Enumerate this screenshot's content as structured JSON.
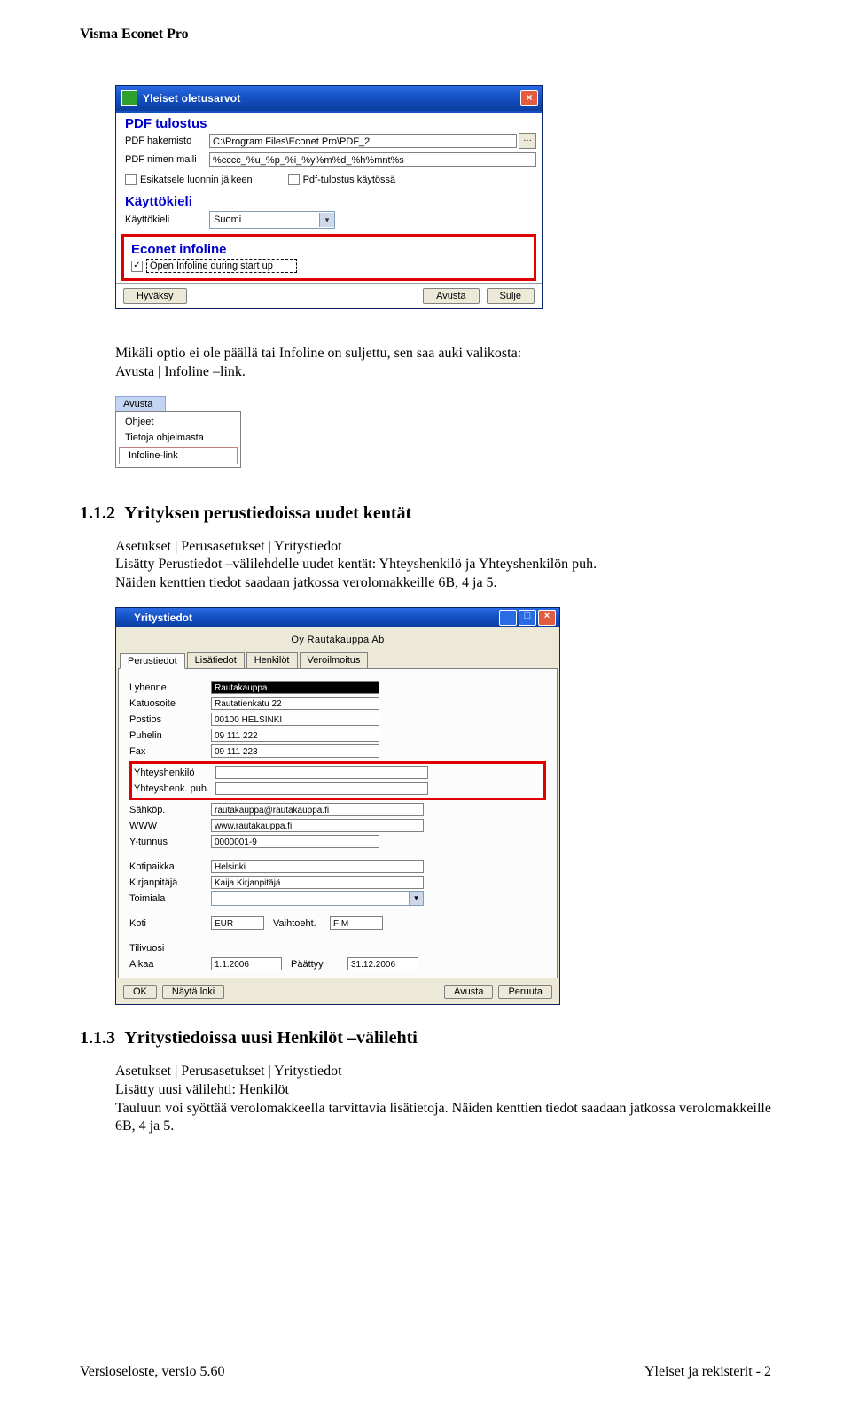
{
  "header": "Visma Econet Pro",
  "dialog1": {
    "title": "Yleiset oletusarvot",
    "section1": "PDF tulostus",
    "pdf_dir_label": "PDF hakemisto",
    "pdf_dir_value": "C:\\Program Files\\Econet Pro\\PDF_2",
    "pdf_name_label": "PDF nimen malli",
    "pdf_name_value": "%cccc_%u_%p_%i_%y%m%d_%h%mnt%s",
    "chk_preview": "Esikatsele luonnin jälkeen",
    "chk_enable": "Pdf-tulostus käytössä",
    "section2": "Käyttökieli",
    "lang_label": "Käyttökieli",
    "lang_value": "Suomi",
    "section3": "Econet infoline",
    "chk_open": "Open Infoline during start up",
    "btn_ok": "Hyväksy",
    "btn_help": "Avusta",
    "btn_close": "Sulje"
  },
  "para1_line1": "Mikäli optio ei ole päällä tai Infoline on suljettu, sen saa auki valikosta:",
  "para1_line2": "Avusta | Infoline –link.",
  "menu": {
    "tab": "Avusta",
    "items": [
      "Ohjeet",
      "Tietoja ohjelmasta",
      "Infoline-link"
    ]
  },
  "section112": {
    "number": "1.1.2",
    "title": "Yrityksen perustiedoissa uudet kentät",
    "p_line1": "Asetukset | Perusasetukset | Yritystiedot",
    "p_line2": "Lisätty Perustiedot –välilehdelle uudet kentät: Yhteyshenkilö ja Yhteyshenkilön puh.",
    "p_line3": "Näiden kenttien tiedot saadaan jatkossa verolomakkeille 6B, 4 ja 5."
  },
  "dialog2": {
    "title": "Yritystiedot",
    "company": "Oy Rautakauppa Ab",
    "tabs": [
      "Perustiedot",
      "Lisätiedot",
      "Henkilöt",
      "Veroilmoitus"
    ],
    "fields": {
      "lyhenne": {
        "label": "Lyhenne",
        "value": "Rautakauppa"
      },
      "katuosoite": {
        "label": "Katuosoite",
        "value": "Rautatienkatu 22"
      },
      "postios": {
        "label": "Postios",
        "value": "00100 HELSINKI"
      },
      "puhelin": {
        "label": "Puhelin",
        "value": "09 111 222"
      },
      "fax": {
        "label": "Fax",
        "value": "09 111 223"
      },
      "yhteyshenk": {
        "label": "Yhteyshenkilö",
        "value": ""
      },
      "yhteyspuh": {
        "label": "Yhteyshenk. puh.",
        "value": ""
      },
      "sahkop": {
        "label": "Sähköp.",
        "value": "rautakauppa@rautakauppa.fi"
      },
      "www": {
        "label": "WWW",
        "value": "www.rautakauppa.fi"
      },
      "ytunnus": {
        "label": "Y-tunnus",
        "value": "0000001-9"
      },
      "kotipaikka": {
        "label": "Kotipaikka",
        "value": "Helsinki"
      },
      "kirjanpitaja": {
        "label": "Kirjanpitäjä",
        "value": "Kaija Kirjanpitäjä"
      },
      "toimiala": {
        "label": "Toimiala",
        "value": ""
      },
      "koti": {
        "label": "Koti",
        "value": "EUR"
      },
      "vaihtoehtolbl": "Vaihtoeht.",
      "vaihtoehtoval": "FIM",
      "tilivuosi": {
        "label": "Tilivuosi",
        "value": ""
      },
      "alkaa": {
        "label": "Alkaa",
        "value": "1.1.2006"
      },
      "paattyylbl": "Päättyy",
      "paattyyval": "31.12.2006"
    },
    "btn_ok": "OK",
    "btn_log": "Näytä loki",
    "btn_help": "Avusta",
    "btn_cancel": "Peruuta"
  },
  "section113": {
    "number": "1.1.3",
    "title": "Yritystiedoissa uusi Henkilöt –välilehti",
    "p_line1": "Asetukset | Perusasetukset | Yritystiedot",
    "p_line2": "Lisätty uusi välilehti: Henkilöt",
    "p_line3": "Tauluun voi syöttää verolomakkeella tarvittavia lisätietoja. Näiden kenttien tiedot saadaan jatkossa verolomakkeille 6B, 4 ja 5."
  },
  "footer": {
    "left": "Versioseloste, versio 5.60",
    "right": "Yleiset ja rekisterit - 2"
  }
}
